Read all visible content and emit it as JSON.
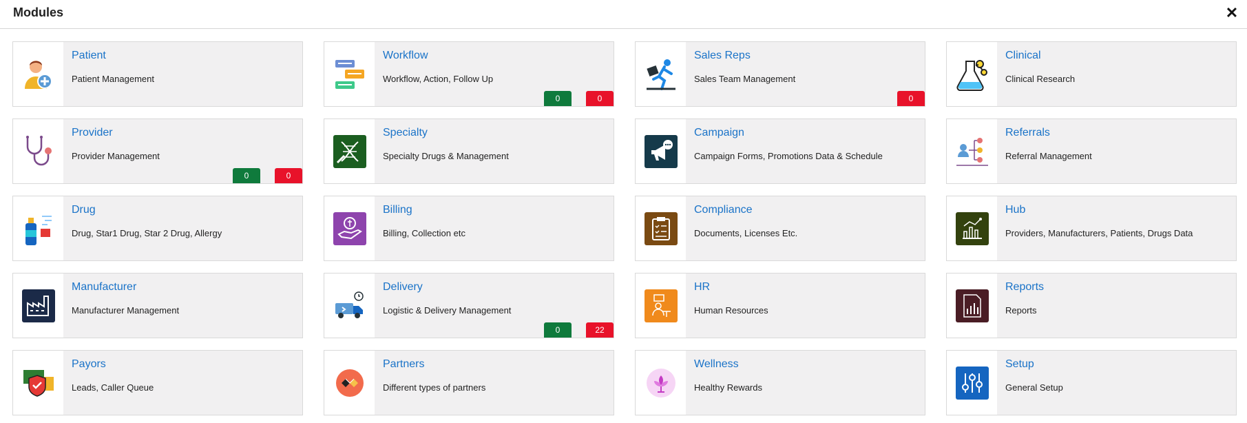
{
  "header": {
    "title": "Modules",
    "close_label": "✕"
  },
  "modules": [
    {
      "title": "Patient",
      "desc": "Patient Management",
      "icon": "patient-icon"
    },
    {
      "title": "Workflow",
      "desc": "Workflow, Action, Follow Up",
      "icon": "workflow-icon",
      "green": "0",
      "red": "0"
    },
    {
      "title": "Sales Reps",
      "desc": "Sales Team Management",
      "icon": "sales-reps-icon",
      "red": "0"
    },
    {
      "title": "Clinical",
      "desc": "Clinical Research",
      "icon": "clinical-flask-icon"
    },
    {
      "title": "Provider",
      "desc": "Provider Management",
      "icon": "stethoscope-icon",
      "green": "0",
      "red": "0"
    },
    {
      "title": "Specialty",
      "desc": "Specialty Drugs & Management",
      "icon": "dna-syringe-icon"
    },
    {
      "title": "Campaign",
      "desc": "Campaign Forms, Promotions Data & Schedule",
      "icon": "megaphone-icon"
    },
    {
      "title": "Referrals",
      "desc": "Referral Management",
      "icon": "referrals-icon"
    },
    {
      "title": "Drug",
      "desc": "Drug, Star1 Drug, Star 2 Drug, Allergy",
      "icon": "drug-bottle-icon"
    },
    {
      "title": "Billing",
      "desc": "Billing, Collection etc",
      "icon": "billing-hand-coin-icon"
    },
    {
      "title": "Compliance",
      "desc": "Documents, Licenses Etc.",
      "icon": "clipboard-icon"
    },
    {
      "title": "Hub",
      "desc": "Providers, Manufacturers, Patients, Drugs Data",
      "icon": "hub-chart-icon"
    },
    {
      "title": "Manufacturer",
      "desc": "Manufacturer Management",
      "icon": "factory-icon"
    },
    {
      "title": "Delivery",
      "desc": "Logistic & Delivery Management",
      "icon": "delivery-truck-icon",
      "green": "0",
      "red": "22"
    },
    {
      "title": "HR",
      "desc": "Human Resources",
      "icon": "hr-person-icon"
    },
    {
      "title": "Reports",
      "desc": "Reports",
      "icon": "reports-document-icon"
    },
    {
      "title": "Payors",
      "desc": "Leads, Caller Queue",
      "icon": "payors-shield-icon"
    },
    {
      "title": "Partners",
      "desc": "Different types of partners",
      "icon": "partners-icon"
    },
    {
      "title": "Wellness",
      "desc": "Healthy Rewards",
      "icon": "wellness-lotus-icon"
    },
    {
      "title": "Setup",
      "desc": "General Setup",
      "icon": "sliders-icon"
    }
  ]
}
